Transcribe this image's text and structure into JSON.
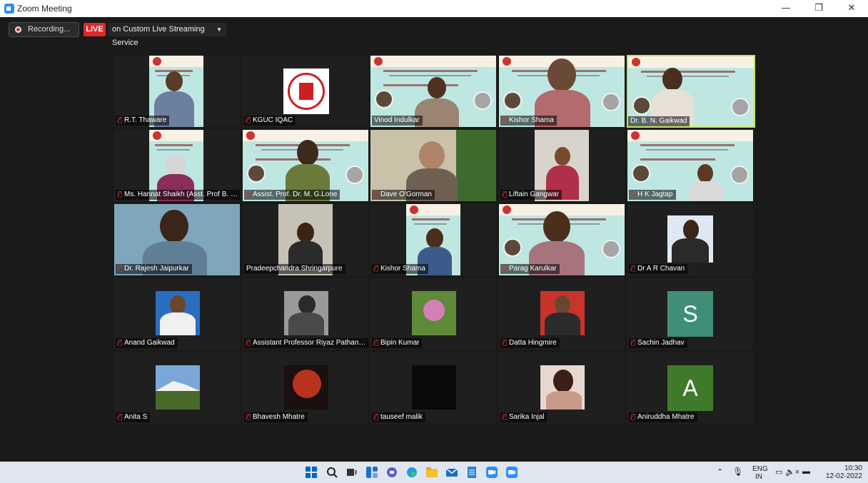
{
  "window": {
    "title": "Zoom Meeting",
    "controls": {
      "minimize": "—",
      "restore": "❐",
      "close": "✕"
    }
  },
  "toolbar": {
    "recording_label": "Recording...",
    "live_badge": "LIVE",
    "stream_label": "on Custom Live Streaming Service"
  },
  "colors": {
    "live_red": "#e02828",
    "mic_muted_red": "#e23a3a",
    "active_speaker_border": "#c8e35a",
    "zoom_blue": "#2d8cff"
  },
  "participants": [
    {
      "name": "R.T. Thaware",
      "muted": true
    },
    {
      "name": "KGUC IQAC",
      "muted": true
    },
    {
      "name": "Vinod Indulkar",
      "muted": false
    },
    {
      "name": "Kishor Shama",
      "muted": true
    },
    {
      "name": "Dr. B. N. Gaikwad",
      "muted": false,
      "active": true
    },
    {
      "name": "Ms. Hannat Shaikh (Asst. Prof B. C...",
      "muted": true
    },
    {
      "name": "Assist. Prof. Dr. M. G.Lone",
      "muted": true
    },
    {
      "name": "Dave O'Gorman",
      "muted": true
    },
    {
      "name": "Liftain Gangwar",
      "muted": true
    },
    {
      "name": "H K Jagtap",
      "muted": true
    },
    {
      "name": "Dr. Rajesh Jaipurkar",
      "muted": true
    },
    {
      "name": "Pradeepchandra Shringarpure",
      "muted": false
    },
    {
      "name": "Kishor Shama",
      "muted": true
    },
    {
      "name": "Parag Karulkar",
      "muted": true
    },
    {
      "name": "Dr A R Chavan",
      "muted": true
    },
    {
      "name": "Anand Gaikwad",
      "muted": true
    },
    {
      "name": "Assistant Professor Riyaz Pathan(...",
      "muted": true
    },
    {
      "name": "Bipin Kumar",
      "muted": true
    },
    {
      "name": "Datta Hingmire",
      "muted": true
    },
    {
      "name": "Sachin Jadhav",
      "muted": true,
      "avatar_letter": "S"
    },
    {
      "name": "Anita S",
      "muted": true
    },
    {
      "name": "Bhavesh Mhatre",
      "muted": true
    },
    {
      "name": "tauseef malik",
      "muted": true
    },
    {
      "name": "Sarika Injal",
      "muted": true
    },
    {
      "name": "Aniruddha Mhatre",
      "muted": true,
      "avatar_letter": "A"
    }
  ],
  "taskbar": {
    "language": "ENG",
    "region": "IN",
    "time": "10:30",
    "date": "12-02-2022"
  }
}
